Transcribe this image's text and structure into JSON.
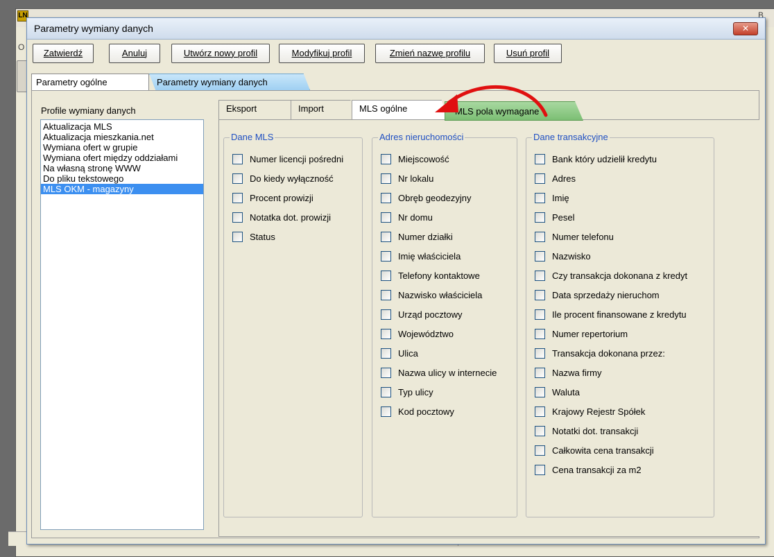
{
  "background_app": {
    "logo": "LN",
    "menu_letter": "O",
    "right_letter": "B"
  },
  "dialog": {
    "title": "Parametry wymiany danych",
    "close_glyph": "✕"
  },
  "toolbar": {
    "buttons": [
      {
        "label": "Zatwierdź"
      },
      {
        "label": "Anuluj"
      },
      {
        "label": "Utwórz nowy profil"
      },
      {
        "label": "Modyfikuj profil"
      },
      {
        "label": "Zmień nazwę profilu"
      },
      {
        "label": "Usuń profil"
      }
    ]
  },
  "outer_tabs": [
    {
      "label": "Parametry ogólne"
    },
    {
      "label": "Parametry wymiany danych"
    }
  ],
  "profiles": {
    "label": "Profile wymiany danych",
    "items": [
      "Aktualizacja MLS",
      "Aktualizacja mieszkania.net",
      "Wymiana ofert w grupie",
      "Wymiana ofert między oddziałami",
      "Na własną stronę WWW",
      "Do pliku tekstowego",
      "MLS OKM - magazyny"
    ],
    "selected": "MLS OKM - magazyny"
  },
  "inner_tabs": [
    {
      "label": "Eksport"
    },
    {
      "label": "Import"
    },
    {
      "label": "MLS ogólne"
    },
    {
      "label": "MLS pola wymagane"
    }
  ],
  "groups": {
    "dane_mls": {
      "title": "Dane MLS",
      "items": [
        "Numer licencji pośredni",
        "Do kiedy wyłączność",
        "Procent prowizji",
        "Notatka dot. prowizji",
        "Status"
      ]
    },
    "adres": {
      "title": "Adres nieruchomości",
      "items": [
        "Miejscowość",
        "Nr lokalu",
        "Obręb geodezyjny",
        "Nr domu",
        "Numer działki",
        "Imię właściciela",
        "Telefony kontaktowe",
        "Nazwisko właściciela",
        "Urząd pocztowy",
        "Województwo",
        "Ulica",
        "Nazwa ulicy w internecie",
        "Typ ulicy",
        "Kod pocztowy"
      ]
    },
    "transakcja": {
      "title": "Dane transakcyjne",
      "items": [
        "Bank który udzielił kredytu",
        "Adres",
        "Imię",
        "Pesel",
        "Numer telefonu",
        "Nazwisko",
        "Czy transakcja dokonana z kredyt",
        "Data sprzedaży nieruchom",
        "Ile procent finansowane z kredytu",
        "Numer repertorium",
        "Transakcja dokonana przez:",
        "Nazwa firmy",
        "Waluta",
        "Krajowy Rejestr Spółek",
        "Notatki dot. transakcji",
        "Całkowita cena transakcji",
        "Cena transakcji za m2"
      ]
    }
  },
  "colors": {
    "group_title": "#1f4fc2",
    "selected_row": "#3c8ff0",
    "arrow": "#e01010"
  }
}
